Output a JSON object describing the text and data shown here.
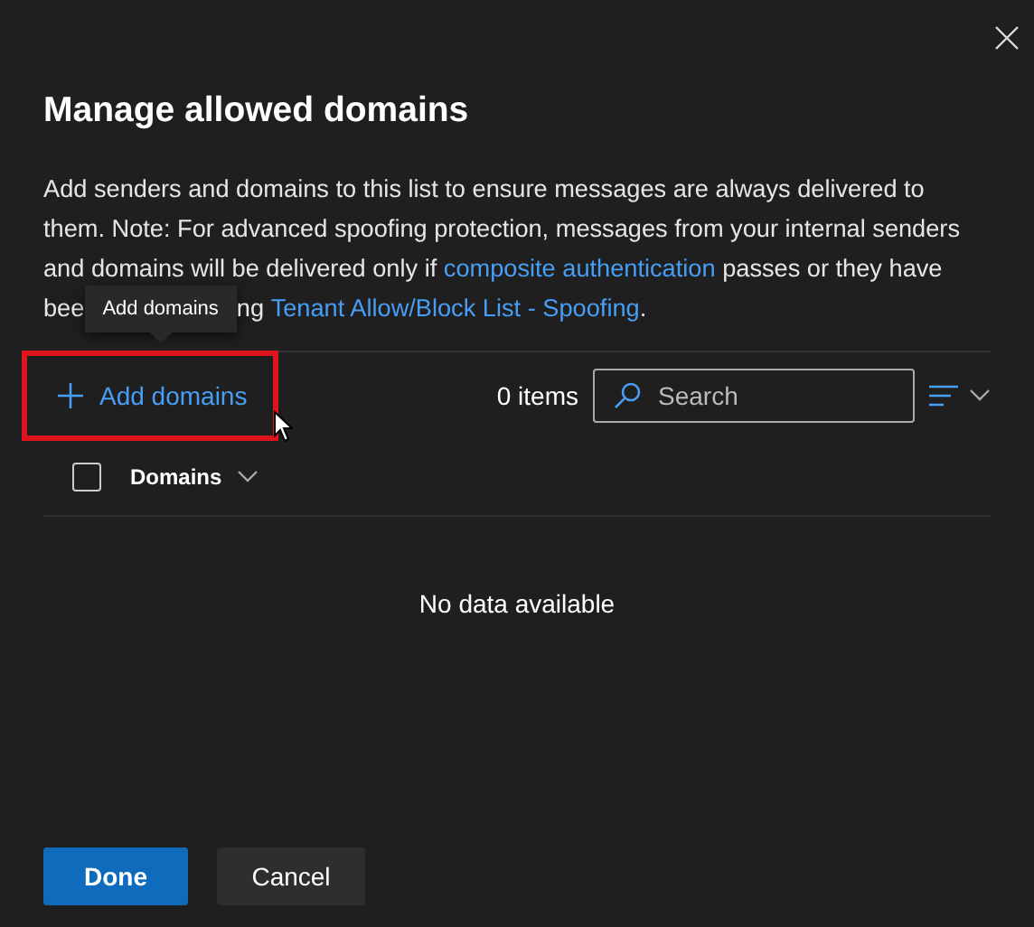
{
  "dialog": {
    "title": "Manage allowed domains"
  },
  "description": [
    {
      "kind": "text",
      "text": "Add senders and domains to this list to ensure messages are always delivered to them. Note: For advanced spoofing protection, messages from your internal senders and domains will be delivered only if "
    },
    {
      "kind": "link",
      "text": "composite authentication"
    },
    {
      "kind": "text",
      "text": " passes or they have"
    }
  ],
  "description_continued": [
    {
      "kind": "text",
      "text": "bee"
    },
    {
      "kind": "tooltip",
      "text": "Add domains"
    },
    {
      "kind": "text",
      "text": "ng "
    },
    {
      "kind": "link",
      "text": "Tenant Allow/Block List - Spoofing"
    },
    {
      "kind": "text",
      "text": "."
    }
  ],
  "toolbar": {
    "add_button": {
      "label": "Add domains",
      "highlighted": true
    },
    "item_count": "0 items",
    "search": {
      "placeholder": "Search"
    }
  },
  "table": {
    "select_all": {
      "checked": false
    },
    "columns": [
      {
        "label": "Domains"
      }
    ],
    "empty_message": "No data available"
  },
  "buttons": [
    {
      "label": "Done",
      "kind": "primary"
    },
    {
      "label": "Cancel",
      "kind": "secondary"
    }
  ]
}
